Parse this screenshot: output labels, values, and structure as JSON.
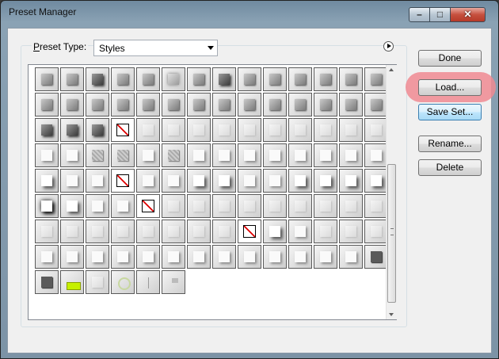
{
  "window": {
    "title": "Preset Manager"
  },
  "preset_type": {
    "label": "Preset Type:",
    "mnemonic": "P",
    "rest": "reset Type:",
    "value": "Styles"
  },
  "buttons": {
    "done": "Done",
    "load": "Load...",
    "save_set": "Save Set...",
    "rename": "Rename...",
    "delete": "Delete"
  },
  "colors": {
    "highlight": "#f08a92",
    "default_button": "#a7d9f5"
  },
  "swatch_count": 118
}
